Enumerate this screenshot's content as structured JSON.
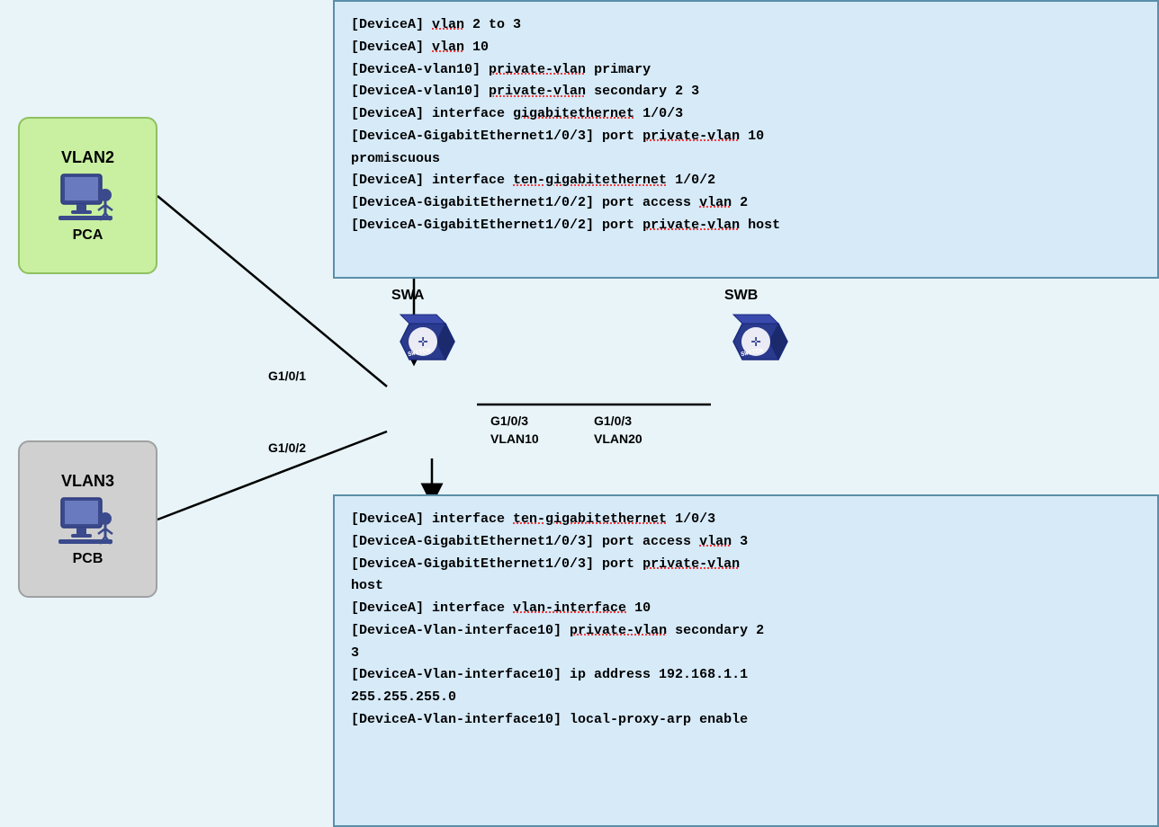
{
  "codeTop": {
    "lines": [
      {
        "text": "[DeviceA] ",
        "underline": false,
        "after": "vlan",
        "afterUnderline": true,
        "rest": " 2 to 3"
      },
      {
        "text": "[DeviceA] ",
        "underline": false,
        "after": "vlan",
        "afterUnderline": true,
        "rest": " 10"
      },
      {
        "text": "[DeviceA-vlan10] ",
        "underline": false,
        "after": "private-vlan",
        "afterUnderline": true,
        "rest": " primary"
      },
      {
        "text": "[DeviceA-vlan10] ",
        "underline": false,
        "after": "private-vlan",
        "afterUnderline": true,
        "rest": " secondary 2 3"
      },
      {
        "text": "[DeviceA] interface ",
        "underline": false,
        "after": "gigabitethernet",
        "afterUnderline": true,
        "rest": " 1/0/3"
      },
      {
        "text": "[DeviceA-GigabitEthernet1/0/3] port ",
        "underline": false,
        "after": "private-vlan",
        "afterUnderline": true,
        "rest": " 10"
      },
      {
        "text": "promiscuous",
        "underline": false,
        "after": "",
        "afterUnderline": false,
        "rest": ""
      },
      {
        "text": "[DeviceA] interface ",
        "underline": false,
        "after": "ten-gigabitethernet",
        "afterUnderline": true,
        "rest": " 1/0/2"
      },
      {
        "text": "[DeviceA-GigabitEthernet1/0/2] port access ",
        "underline": false,
        "after": "vlan",
        "afterUnderline": true,
        "rest": " 2"
      },
      {
        "text": "[DeviceA-GigabitEthernet1/0/2] port ",
        "underline": false,
        "after": "private-vlan",
        "afterUnderline": true,
        "rest": " host"
      }
    ]
  },
  "codeBottom": {
    "lines": [
      {
        "text": "[DeviceA] interface ",
        "underline": false,
        "after": "ten-gigabitethernet",
        "afterUnderline": true,
        "rest": " 1/0/3"
      },
      {
        "text": "[DeviceA-GigabitEthernet1/0/3] port access ",
        "underline": false,
        "after": "vlan",
        "afterUnderline": true,
        "rest": " 3"
      },
      {
        "text": "[DeviceA-GigabitEthernet1/0/3] port ",
        "underline": false,
        "after": "private-vlan",
        "afterUnderline": true,
        "rest": ""
      },
      {
        "text": "host",
        "underline": false,
        "after": "",
        "afterUnderline": false,
        "rest": ""
      },
      {
        "text": "[DeviceA] interface ",
        "underline": false,
        "after": "vlan-interface",
        "afterUnderline": true,
        "rest": " 10"
      },
      {
        "text": "[DeviceA-Vlan-interface10] ",
        "underline": false,
        "after": "private-vlan",
        "afterUnderline": true,
        "rest": " secondary 2"
      },
      {
        "text": "3",
        "underline": false,
        "after": "",
        "afterUnderline": false,
        "rest": ""
      },
      {
        "text": "[DeviceA-Vlan-interface10] ip address 192.168.1.1",
        "underline": false,
        "after": "",
        "afterUnderline": false,
        "rest": ""
      },
      {
        "text": "255.255.255.0",
        "underline": false,
        "after": "",
        "afterUnderline": false,
        "rest": ""
      },
      {
        "text": "[DeviceA-Vlan-interface10] ",
        "underline": false,
        "after": "local-proxy-arp",
        "afterUnderline": false,
        "rest": " enable"
      }
    ]
  },
  "vlan2": {
    "title": "VLAN2",
    "pcLabel": "PCA"
  },
  "vlan3": {
    "title": "VLAN3",
    "pcLabel": "PCB"
  },
  "diagram": {
    "swa": "SWA",
    "swb": "SWB",
    "switchText": "SwitCH",
    "ports": {
      "g101": "G1/0/1",
      "g102": "G1/0/2",
      "g103swa": "G1/0/3",
      "g103swb": "G1/0/3",
      "vlan10": "VLAN10",
      "vlan20": "VLAN20"
    }
  }
}
